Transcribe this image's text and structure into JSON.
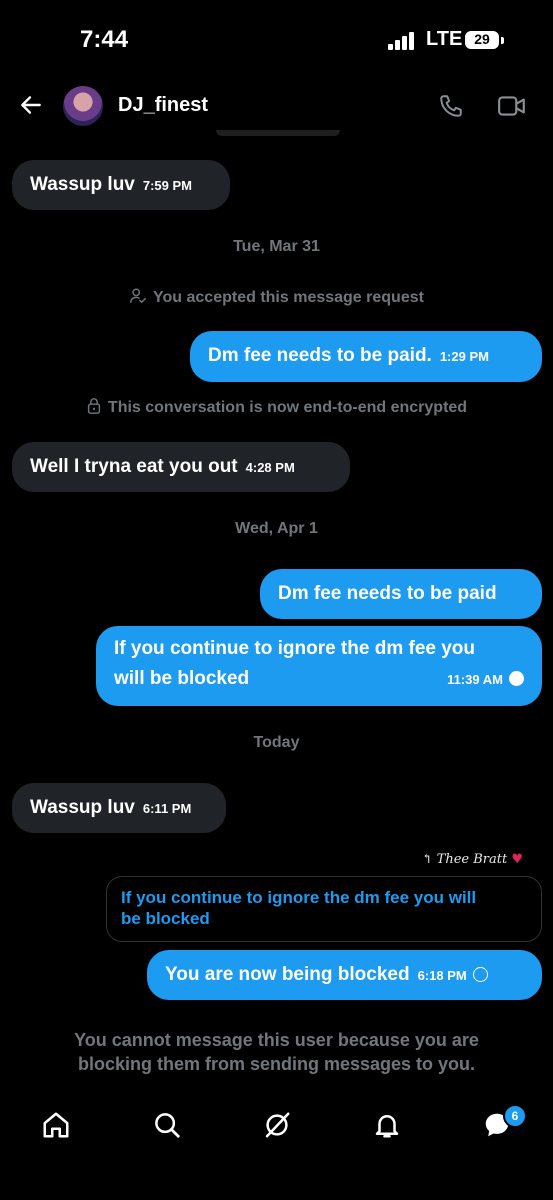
{
  "status_bar": {
    "time": "7:44",
    "network": "LTE",
    "battery": "29"
  },
  "header": {
    "username": "DJ_finest",
    "icons": [
      "back-arrow-icon",
      "phone-icon",
      "video-icon"
    ]
  },
  "messages": {
    "m1": {
      "text": "Wassup luv",
      "time": "7:59 PM"
    },
    "date1": "Tue, Mar 31",
    "sys1": "You accepted this message request",
    "m2": {
      "text": "Dm fee needs to be paid.",
      "time": "1:29 PM"
    },
    "sys2": "This conversation is now end-to-end encrypted",
    "m3": {
      "text": "Well I tryna eat you out",
      "time": "4:28 PM"
    },
    "date2": "Wed, Apr 1",
    "m4": {
      "text": "Dm fee needs to be paid"
    },
    "m5": {
      "line1": "If you continue to ignore the dm fee you",
      "line2": "will be blocked",
      "time": "11:39 AM"
    },
    "date3": "Today",
    "m6": {
      "text": "Wassup luv",
      "time": "6:11 PM"
    },
    "reply_to": "Thee Bratt",
    "quoted": {
      "line1": "If you continue to ignore the dm fee you will",
      "line2": "be blocked"
    },
    "m7": {
      "text": "You are now being blocked",
      "time": "6:18 PM"
    }
  },
  "blocked_notice": {
    "line1": "You cannot message this user because you are",
    "line2": "blocking them from sending messages to you."
  },
  "nav": {
    "icons": [
      "home-icon",
      "search-icon",
      "grok-icon",
      "notifications-icon",
      "messages-icon"
    ],
    "messages_badge": "6"
  },
  "colors": {
    "accent": "#1d9bf0",
    "incoming_bubble": "#202327",
    "muted": "#71767b",
    "background": "#000000"
  }
}
